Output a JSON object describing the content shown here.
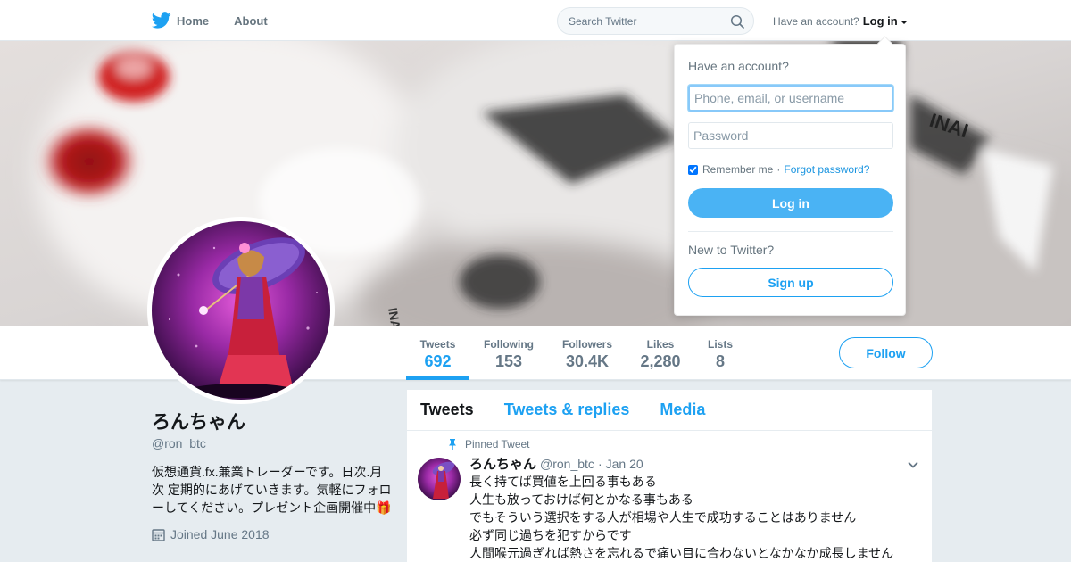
{
  "nav": {
    "home_label": "Home",
    "about_label": "About",
    "search_placeholder": "Search Twitter",
    "account_prompt": "Have an account?",
    "login_label": "Log in"
  },
  "profile": {
    "name": "ろんちゃん",
    "handle": "@ron_btc",
    "bio": "仮想通貨.fx.兼業トレーダーです。日次.月次 定期的にあげていきます。気軽にフォローしてください。プレゼント企画開催中🎁",
    "joined": "Joined June 2018",
    "follow_label": "Follow"
  },
  "stats": [
    {
      "label": "Tweets",
      "value": "692"
    },
    {
      "label": "Following",
      "value": "153"
    },
    {
      "label": "Followers",
      "value": "30.4K"
    },
    {
      "label": "Likes",
      "value": "2,280"
    },
    {
      "label": "Lists",
      "value": "8"
    }
  ],
  "tabs": [
    "Tweets",
    "Tweets & replies",
    "Media"
  ],
  "pinned_tweet": {
    "pinned_label": "Pinned Tweet",
    "name": "ろんちゃん",
    "handle": "@ron_btc",
    "separator": "·",
    "date": "Jan 20",
    "lines": [
      "長く持てば買値を上回る事もある",
      "人生も放っておけば何とかなる事もある",
      "でもそういう選択をする人が相場や人生で成功することはありません",
      "必ず同じ過ちを犯すからです",
      "人間喉元過ぎれば熱さを忘れるで痛い目に合わないとなかなか成長しません"
    ]
  },
  "login_dropdown": {
    "title": "Have an account?",
    "username_placeholder": "Phone, email, or username",
    "password_placeholder": "Password",
    "remember_label": "Remember me",
    "separator": "·",
    "forgot_label": "Forgot password?",
    "login_button": "Log in",
    "new_prompt": "New to Twitter?",
    "signup_button": "Sign up"
  },
  "colors": {
    "accent": "#1da1f2",
    "login_fill": "#4ab3f4",
    "background": "#e6ecf0"
  },
  "icons": [
    "twitter-bird-icon",
    "search-icon",
    "caret-down-icon",
    "calendar-icon",
    "pin-icon",
    "chevron-down-icon",
    "gift-icon"
  ]
}
